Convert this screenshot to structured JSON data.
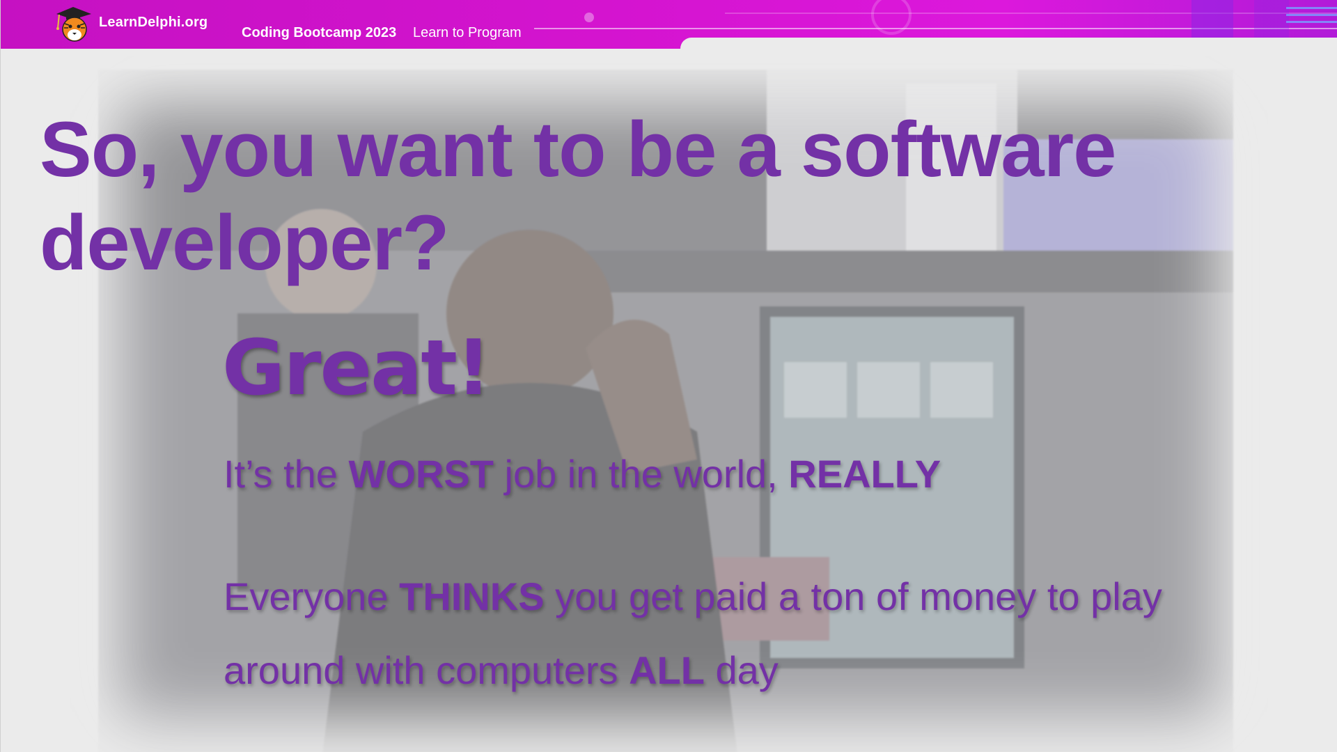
{
  "banner": {
    "site_name": "LearnDelphi.org",
    "title": "Coding Bootcamp 2023",
    "subtitle": "Learn to Program",
    "logo_icon": "tiger-graduate-mascot-icon",
    "colors": {
      "banner_magenta": "#d414cf",
      "banner_purple": "#b11bd8",
      "text_white": "#ffffff"
    }
  },
  "slide": {
    "headline": "So, you want to be a software developer?",
    "exclamation": "Great!",
    "line1": {
      "p1": "It’s the ",
      "b1": "WORST",
      "p2": " job in the world, ",
      "b2": "REALLY"
    },
    "line2": {
      "p1": "Everyone ",
      "b1": "THINKS",
      "p2": " you get paid a ton of money to play"
    },
    "line3": {
      "p1": "around with computers ",
      "b1": "ALL",
      "p2": " day"
    },
    "background_image": "frustrated-gamer-at-computer-photo",
    "colors": {
      "text_purple": "#7331a6",
      "background": "#ebebeb"
    }
  }
}
